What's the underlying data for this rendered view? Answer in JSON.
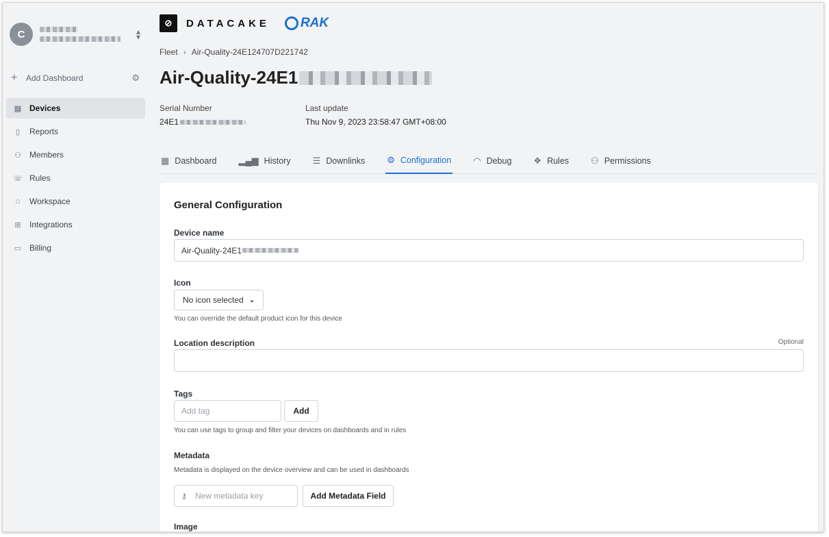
{
  "account": {
    "avatar_letter": "C"
  },
  "sidebar": {
    "add_dashboard": "Add Dashboard",
    "items": [
      {
        "label": "Devices",
        "icon": "devices-icon",
        "active": true
      },
      {
        "label": "Reports",
        "icon": "reports-icon"
      },
      {
        "label": "Members",
        "icon": "members-icon"
      },
      {
        "label": "Rules",
        "icon": "rules-icon"
      },
      {
        "label": "Workspace",
        "icon": "workspace-icon"
      },
      {
        "label": "Integrations",
        "icon": "integrations-icon"
      },
      {
        "label": "Billing",
        "icon": "billing-icon"
      }
    ]
  },
  "header": {
    "brand": "DATACAKE",
    "partner": "RAK",
    "breadcrumb": {
      "root": "Fleet",
      "current": "Air-Quality-24E124707D221742"
    },
    "title": "Air-Quality-24E1",
    "serial_label": "Serial Number",
    "serial_value": "24E1",
    "update_label": "Last update",
    "update_value": "Thu Nov 9, 2023 23:58:47 GMT+08:00"
  },
  "tabs": [
    {
      "label": "Dashboard",
      "icon": "table-icon"
    },
    {
      "label": "History",
      "icon": "bar-chart-icon"
    },
    {
      "label": "Downlinks",
      "icon": "sliders-icon"
    },
    {
      "label": "Configuration",
      "icon": "gear-icon",
      "active": true
    },
    {
      "label": "Debug",
      "icon": "rss-icon"
    },
    {
      "label": "Rules",
      "icon": "rules-icon"
    },
    {
      "label": "Permissions",
      "icon": "users-icon"
    }
  ],
  "config": {
    "section_title": "General Configuration",
    "device_name_label": "Device name",
    "device_name_value": "Air-Quality-24E1",
    "icon_label": "Icon",
    "icon_select_value": "No icon selected",
    "icon_help": "You can override the default product icon for this device",
    "location_label": "Location description",
    "location_optional": "Optional",
    "tags_label": "Tags",
    "tag_placeholder": "Add tag",
    "tag_add_button": "Add",
    "tags_help": "You can use tags to group and filter your devices on dashboards and in rules",
    "metadata_label": "Metadata",
    "metadata_help": "Metadata is displayed on the device overview and can be used in dashboards",
    "metadata_placeholder": "New metadata key",
    "metadata_add_button": "Add Metadata Field",
    "image_label": "Image"
  }
}
